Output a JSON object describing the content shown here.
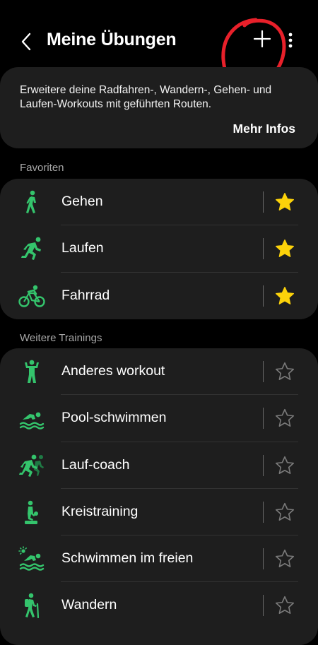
{
  "header": {
    "title": "Meine Übungen"
  },
  "info_card": {
    "text": "Erweitere deine Radfahren-, Wandern-, Gehen- und Laufen-Workouts mit geführten Routen.",
    "link": "Mehr Infos"
  },
  "favorites": {
    "label": "Favoriten",
    "items": [
      {
        "label": "Gehen",
        "icon": "walking-icon",
        "favorite": true
      },
      {
        "label": "Laufen",
        "icon": "running-icon",
        "favorite": true
      },
      {
        "label": "Fahrrad",
        "icon": "cycling-icon",
        "favorite": true
      }
    ]
  },
  "more_trainings": {
    "label": "Weitere Trainings",
    "items": [
      {
        "label": "Anderes workout",
        "icon": "other-workout-icon",
        "favorite": false
      },
      {
        "label": "Pool-schwimmen",
        "icon": "swimming-icon",
        "favorite": false
      },
      {
        "label": "Lauf-coach",
        "icon": "running-coach-icon",
        "favorite": false
      },
      {
        "label": "Kreistraining",
        "icon": "circuit-training-icon",
        "favorite": false
      },
      {
        "label": "Schwimmen im freien",
        "icon": "open-water-swimming-icon",
        "favorite": false
      },
      {
        "label": "Wandern",
        "icon": "hiking-icon",
        "favorite": false
      }
    ]
  },
  "colors": {
    "accent_green": "#34c46c",
    "star_yellow": "#fcd20a",
    "annotation_red": "#e8202a",
    "card_bg": "#1e1e1e"
  }
}
